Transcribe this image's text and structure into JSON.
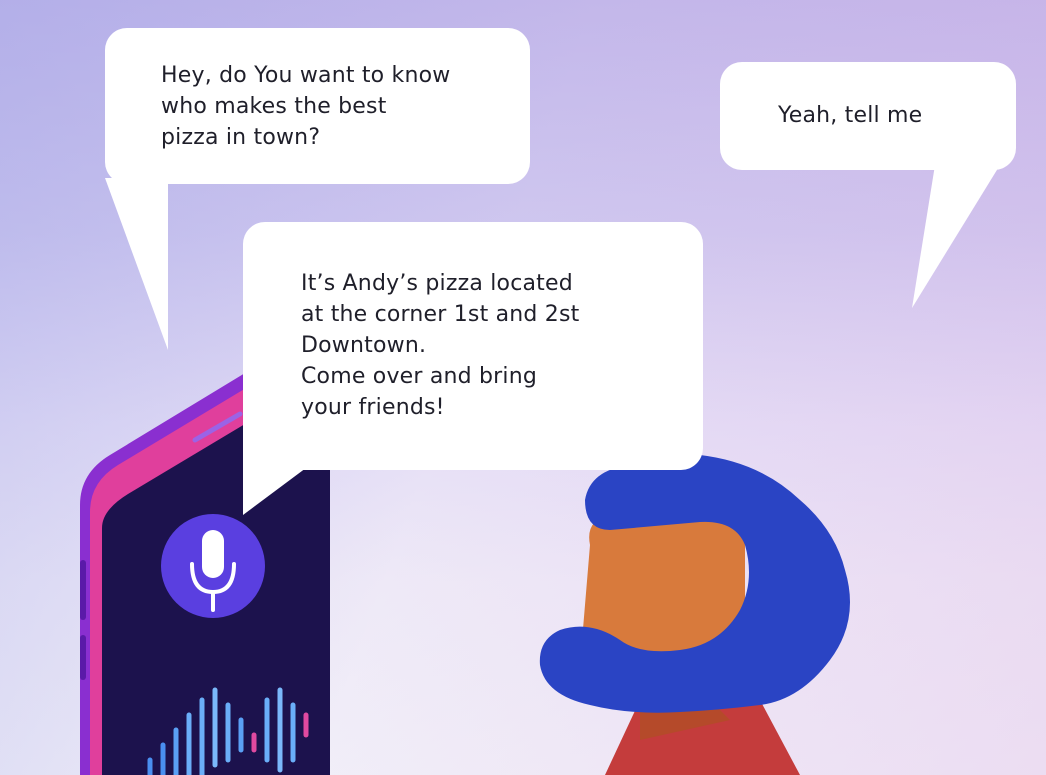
{
  "bubbles": {
    "left": {
      "lines": [
        "Hey, do You want to know",
        "who makes the best",
        "pizza in town?"
      ]
    },
    "right": {
      "lines": [
        "Yeah, tell me"
      ]
    },
    "middle": {
      "lines": [
        "It’s Andy’s pizza located",
        "at the corner 1st and 2st",
        "Downtown.",
        "Come over and bring",
        "your friends!"
      ]
    }
  },
  "icons": {
    "microphone": "microphone-icon",
    "sound_wave": "sound-wave-icon"
  },
  "colors": {
    "phone_body": "#6a2cc0",
    "phone_edge": "#e04aa0",
    "phone_screen": "#1e1452",
    "mic_circle": "#5a3fe0",
    "hair": "#2a44c4",
    "skin": "#d87a3c",
    "shirt": "#c43a3a"
  }
}
